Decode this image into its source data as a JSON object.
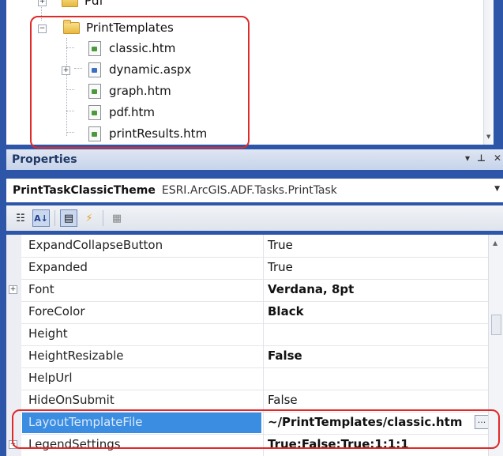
{
  "tree": {
    "items": [
      {
        "label": "Pdf",
        "type": "folder"
      },
      {
        "label": "PrintTemplates",
        "type": "folder-open"
      },
      {
        "label": "classic.htm",
        "type": "file"
      },
      {
        "label": "dynamic.aspx",
        "type": "file"
      },
      {
        "label": "graph.htm",
        "type": "file"
      },
      {
        "label": "pdf.htm",
        "type": "file"
      },
      {
        "label": "printResults.htm",
        "type": "file"
      }
    ]
  },
  "properties": {
    "title": "Properties",
    "object_name": "PrintTaskClassicTheme",
    "object_type": "ESRI.ArcGIS.ADF.Tasks.PrintTask",
    "rows": [
      {
        "name": "ExpandCollapseButton",
        "value": "True"
      },
      {
        "name": "Expanded",
        "value": "True"
      },
      {
        "name": "Font",
        "value": "Verdana, 8pt"
      },
      {
        "name": "ForeColor",
        "value": "Black"
      },
      {
        "name": "Height",
        "value": ""
      },
      {
        "name": "HeightResizable",
        "value": "False"
      },
      {
        "name": "HelpUrl",
        "value": ""
      },
      {
        "name": "HideOnSubmit",
        "value": "False"
      },
      {
        "name": "LayoutTemplateFile",
        "value": "~/PrintTemplates/classic.htm"
      },
      {
        "name": "LegendSettings",
        "value": "True:False:True:1:1:1"
      }
    ],
    "ellipsis": "..."
  },
  "colors": {
    "highlight": "#e02a2a",
    "selection": "#3a8de0",
    "frame": "#2d55a8"
  }
}
